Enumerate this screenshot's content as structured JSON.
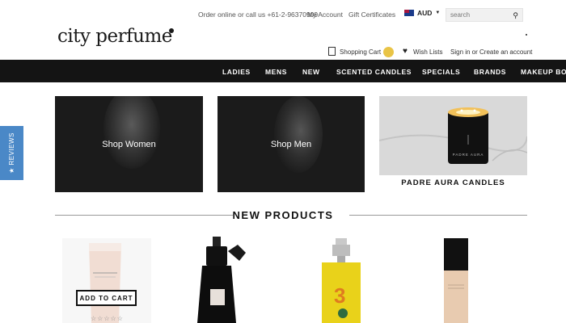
{
  "topbar": {
    "order_text": "Order online or call us +61-2-96370909",
    "my_account": "My Account",
    "gift_certificates": "Gift Certificates",
    "currency": "AUD",
    "search_placeholder": "search"
  },
  "header": {
    "logo": "city perfume",
    "shopping_cart": "Shopping Cart",
    "wish_lists": "Wish Lists",
    "sign_in": "Sign in or Create an account"
  },
  "nav": {
    "items": [
      "LADIES",
      "MENS",
      "NEW",
      "SCENTED CANDLES",
      "SPECIALS",
      "BRANDS",
      "MAKEUP BO"
    ]
  },
  "reviews_tab": "★ REVIEWS",
  "banners": {
    "women": "Shop Women",
    "men": "Shop Men",
    "candles": "PADRE AURA CANDLES",
    "candle_label": "PADRE AURA"
  },
  "new_products": {
    "title": "NEW PRODUCTS",
    "add_to_cart": "ADD TO CART",
    "stars": "☆☆☆☆☆"
  },
  "colors": {
    "nav_bg": "#141414",
    "reviews_blue": "#4a88c7",
    "cart_badge": "#e9c446"
  }
}
